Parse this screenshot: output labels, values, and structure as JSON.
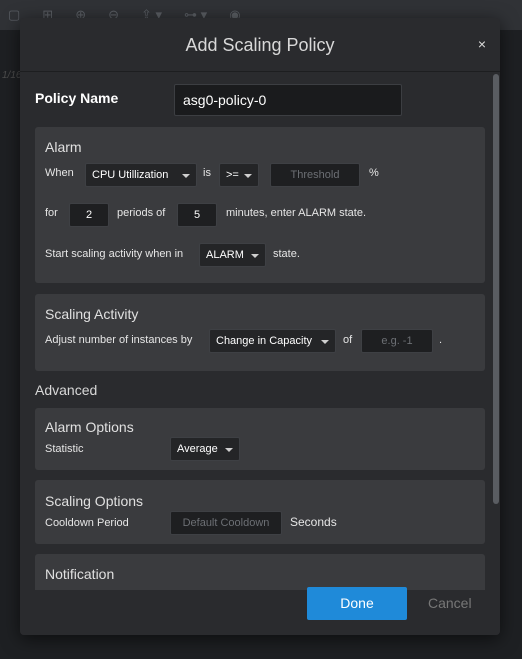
{
  "background": {
    "canvas_tag": "1/16"
  },
  "modal": {
    "title": "Add Scaling Policy",
    "close_icon": "×"
  },
  "policy": {
    "label": "Policy Name",
    "value": "asg0-policy-0"
  },
  "alarm": {
    "title": "Alarm",
    "when": "When",
    "metric": "CPU Utillization",
    "is": "is",
    "operator": ">=",
    "threshold_placeholder": "Threshold",
    "percent": "%",
    "for": "for",
    "periods": "2",
    "periods_of": "periods of",
    "minutes": "5",
    "minutes_suffix": "minutes, enter ALARM state.",
    "start_prefix": "Start scaling activity when in",
    "state": "ALARM",
    "state_suffix": "state."
  },
  "scaling_activity": {
    "title": "Scaling Activity",
    "adjust_label": "Adjust number of instances by",
    "adjust_type": "Change in Capacity",
    "of": "of",
    "amount_placeholder": "e.g. -1",
    "period": "."
  },
  "advanced": {
    "heading": "Advanced",
    "alarm_options": {
      "title": "Alarm Options",
      "statistic_label": "Statistic",
      "statistic_value": "Average"
    },
    "scaling_options": {
      "title": "Scaling Options",
      "cooldown_label": "Cooldown Period",
      "cooldown_placeholder": "Default Cooldown",
      "cooldown_unit": "Seconds"
    },
    "notification": {
      "title": "Notification"
    }
  },
  "footer": {
    "done": "Done",
    "cancel": "Cancel"
  },
  "colors": {
    "primary": "#1f8ad9",
    "panel": "#3a3b3e",
    "modal_bg": "#2a2b2e"
  }
}
